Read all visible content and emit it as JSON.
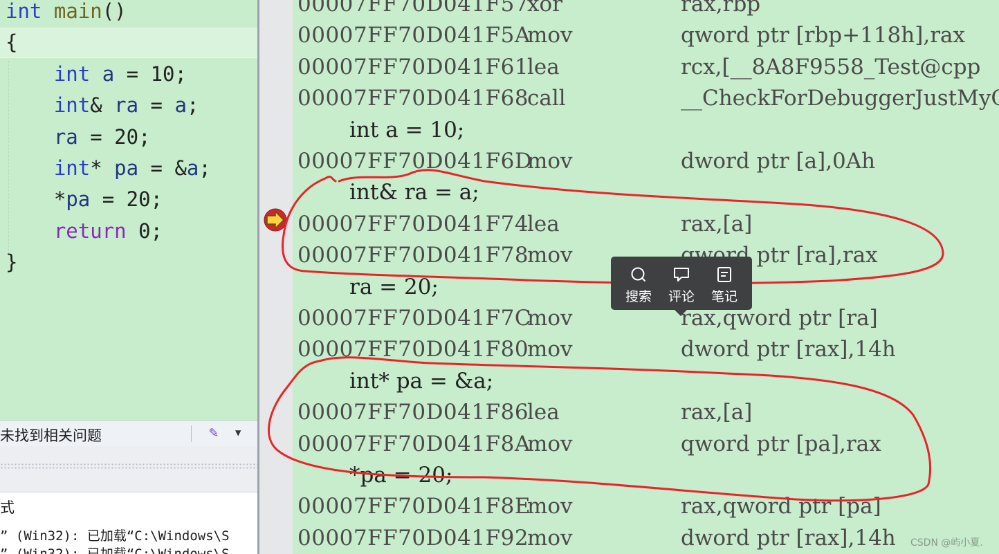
{
  "source_editor": {
    "lines": [
      [
        {
          "t": "int",
          "c": "kw"
        },
        {
          "t": " ",
          "c": "pl"
        },
        {
          "t": "main",
          "c": "fn"
        },
        {
          "t": "()",
          "c": "pl"
        }
      ],
      [
        {
          "t": "{",
          "c": "pl"
        }
      ],
      [
        {
          "t": "    ",
          "c": "pl"
        },
        {
          "t": "int",
          "c": "kw"
        },
        {
          "t": " ",
          "c": "pl"
        },
        {
          "t": "a",
          "c": "id"
        },
        {
          "t": " = ",
          "c": "pl"
        },
        {
          "t": "10",
          "c": "num"
        },
        {
          "t": ";",
          "c": "pl"
        }
      ],
      [
        {
          "t": "    ",
          "c": "pl"
        },
        {
          "t": "int",
          "c": "kw"
        },
        {
          "t": "& ",
          "c": "pl"
        },
        {
          "t": "ra",
          "c": "id"
        },
        {
          "t": " = ",
          "c": "pl"
        },
        {
          "t": "a",
          "c": "id"
        },
        {
          "t": ";",
          "c": "pl"
        }
      ],
      [
        {
          "t": "    ",
          "c": "pl"
        },
        {
          "t": "ra",
          "c": "id"
        },
        {
          "t": " = ",
          "c": "pl"
        },
        {
          "t": "20",
          "c": "num"
        },
        {
          "t": ";",
          "c": "pl"
        }
      ],
      [
        {
          "t": "    ",
          "c": "pl"
        },
        {
          "t": "int",
          "c": "kw"
        },
        {
          "t": "* ",
          "c": "pl"
        },
        {
          "t": "pa",
          "c": "id"
        },
        {
          "t": " = &",
          "c": "pl"
        },
        {
          "t": "a",
          "c": "id"
        },
        {
          "t": ";",
          "c": "pl"
        }
      ],
      [
        {
          "t": "    ",
          "c": "pl"
        },
        {
          "t": "*",
          "c": "pl"
        },
        {
          "t": "pa",
          "c": "id"
        },
        {
          "t": " = ",
          "c": "pl"
        },
        {
          "t": "20",
          "c": "num"
        },
        {
          "t": ";",
          "c": "pl"
        }
      ],
      [
        {
          "t": "    ",
          "c": "pl"
        },
        {
          "t": "return",
          "c": "kwp"
        },
        {
          "t": " ",
          "c": "pl"
        },
        {
          "t": "0",
          "c": "num"
        },
        {
          "t": ";",
          "c": "pl"
        }
      ],
      [
        {
          "t": "}",
          "c": "pl"
        }
      ]
    ]
  },
  "error_bar": {
    "text": "未找到相关问题"
  },
  "output_panel": {
    "header": "式",
    "lines": [
      "” (Win32): 已加载“C:\\Windows\\S",
      "” (Win32): 已加载“C:\\Windows\\S"
    ]
  },
  "disassembly": {
    "rows": [
      {
        "kind": "asm",
        "addr": "00007FF70D041F57",
        "mn": "xor",
        "op": "rax,rbp"
      },
      {
        "kind": "asm",
        "addr": "00007FF70D041F5A",
        "mn": "mov",
        "op": "qword ptr [rbp+118h],rax"
      },
      {
        "kind": "asm",
        "addr": "00007FF70D041F61",
        "mn": "lea",
        "op": "rcx,[__8A8F9558_Test@cpp"
      },
      {
        "kind": "asm",
        "addr": "00007FF70D041F68",
        "mn": "call",
        "op": "__CheckForDebuggerJustMyC"
      },
      {
        "kind": "src",
        "text": "int a = 10;"
      },
      {
        "kind": "asm",
        "addr": "00007FF70D041F6D",
        "mn": "mov",
        "op": "dword ptr [a],0Ah"
      },
      {
        "kind": "src",
        "text": "int& ra = a;"
      },
      {
        "kind": "asm",
        "addr": "00007FF70D041F74",
        "mn": "lea",
        "op": "rax,[a]"
      },
      {
        "kind": "asm",
        "addr": "00007FF70D041F78",
        "mn": "mov",
        "op": "qword ptr [ra],rax"
      },
      {
        "kind": "src",
        "text": "ra = 20;"
      },
      {
        "kind": "asm",
        "addr": "00007FF70D041F7C",
        "mn": "mov",
        "op": "rax,qword ptr [ra]"
      },
      {
        "kind": "asm",
        "addr": "00007FF70D041F80",
        "mn": "mov",
        "op": "dword ptr [rax],14h"
      },
      {
        "kind": "src",
        "text": "int* pa = &a;"
      },
      {
        "kind": "asm",
        "addr": "00007FF70D041F86",
        "mn": "lea",
        "op": "rax,[a]"
      },
      {
        "kind": "asm",
        "addr": "00007FF70D041F8A",
        "mn": "mov",
        "op": "qword ptr [pa],rax"
      },
      {
        "kind": "src",
        "text": "*pa = 20;"
      },
      {
        "kind": "asm",
        "addr": "00007FF70D041F8E",
        "mn": "mov",
        "op": "rax,qword ptr [pa]"
      },
      {
        "kind": "asm",
        "addr": "00007FF70D041F92",
        "mn": "mov",
        "op": "dword ptr [rax],14h"
      }
    ]
  },
  "popup_toolbar": {
    "items": [
      {
        "label": "搜索",
        "icon": "search-icon"
      },
      {
        "label": "评论",
        "icon": "comment-icon"
      },
      {
        "label": "笔记",
        "icon": "note-icon"
      }
    ]
  },
  "current_instruction_icon": "instruction-pointer-arrow-icon",
  "annotation_color": "#e8242a",
  "watermark": "CSDN @屿小夏."
}
